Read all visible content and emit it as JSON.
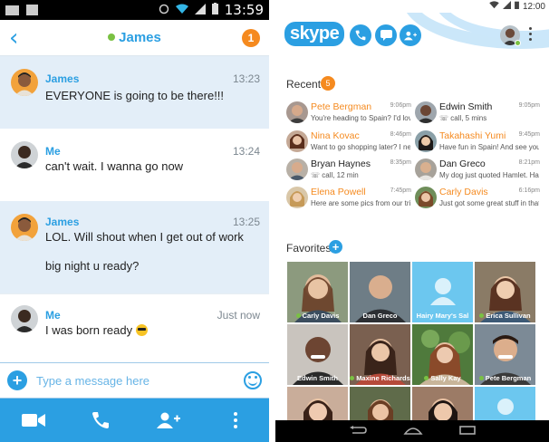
{
  "left_screen": {
    "status_bar": {
      "time": "13:59"
    },
    "header": {
      "contact_name": "James",
      "unread_count": "1",
      "online_color": "#7ac143"
    },
    "messages": [
      {
        "sender": "James",
        "time": "13:23",
        "lines": [
          "EVERYONE is going to be there!!!"
        ]
      },
      {
        "sender": "Me",
        "time": "13:24",
        "lines": [
          "can't wait. I wanna go now"
        ]
      },
      {
        "sender": "James",
        "time": "13:25",
        "lines": [
          "LOL. Will shout when I get out of work",
          "big night u ready?"
        ]
      },
      {
        "sender": "Me",
        "time": "Just now",
        "lines": [
          "I was born ready"
        ]
      }
    ],
    "compose": {
      "placeholder": "Type a message here"
    },
    "toolbar": {
      "icons": [
        "video-call-icon",
        "phone-call-icon",
        "add-contact-icon",
        "overflow-menu-icon"
      ]
    }
  },
  "right_screen": {
    "status_bar": {
      "time": "12:00"
    },
    "logo": "skype",
    "recent": {
      "title": "Recent",
      "count": "5",
      "items": [
        {
          "name": "Pete Bergman",
          "time": "9:06pm",
          "preview": "You're heading to Spain? I'd love to",
          "unread": true
        },
        {
          "name": "Edwin Smith",
          "time": "9:05pm",
          "preview": "call, 5 mins",
          "unread": false
        },
        {
          "name": "Nina Kovac",
          "time": "8:46pm",
          "preview": "Want to go shopping later? I need",
          "unread": true
        },
        {
          "name": "Takahashi Yumi",
          "time": "9:45pm",
          "preview": "Have fun in Spain! And see you when",
          "unread": true
        },
        {
          "name": "Bryan Haynes",
          "time": "8:35pm",
          "preview": "call, 12 min",
          "unread": false
        },
        {
          "name": "Dan Greco",
          "time": "8:21pm",
          "preview": "My dog just quoted Hamlet. Haha. I",
          "unread": false
        },
        {
          "name": "Elena Powell",
          "time": "7:45pm",
          "preview": "Here are some pics from our trip",
          "unread": true
        },
        {
          "name": "Carly Davis",
          "time": "6:16pm",
          "preview": "Just got some great stuff in that",
          "unread": true
        }
      ]
    },
    "favorites": {
      "title": "Favorites",
      "tiles": [
        {
          "name": "Carly Davis",
          "online": true
        },
        {
          "name": "Dan Greco",
          "online": false
        },
        {
          "name": "Hairy Mary's Sal",
          "online": false
        },
        {
          "name": "Erica Sullivan",
          "online": true
        },
        {
          "name": "Edwin Smith",
          "online": false
        },
        {
          "name": "Maxine Richards",
          "online": true
        },
        {
          "name": "Sally Kay",
          "online": true
        },
        {
          "name": "Pete Bergman",
          "online": true
        },
        {
          "name": "",
          "online": false
        },
        {
          "name": "",
          "online": false
        },
        {
          "name": "",
          "online": false
        },
        {
          "name": "",
          "online": false
        }
      ]
    },
    "colors": {
      "accent": "#2b9fe2",
      "unread": "#f58a1f",
      "online": "#7ac143"
    }
  }
}
